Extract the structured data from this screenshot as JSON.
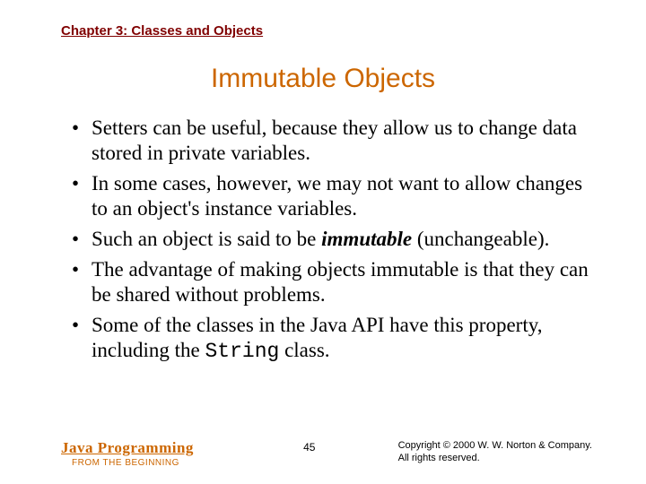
{
  "header": {
    "chapter": "Chapter 3: Classes and Objects"
  },
  "title": "Immutable Objects",
  "bullets": [
    {
      "text": "Setters can be useful, because they allow us to change data stored in private variables."
    },
    {
      "text": "In some cases, however, we may not want to allow changes to an object's instance variables."
    },
    {
      "pre": "Such an object is said to be ",
      "em": "immutable",
      "post": " (unchangeable)."
    },
    {
      "text": "The advantage of making objects immutable is that they can be shared without problems."
    },
    {
      "pre": "Some of the classes in the Java API have this property, including the ",
      "code": "String",
      "post": " class."
    }
  ],
  "footer": {
    "book_title": "Java Programming",
    "book_subtitle": "FROM THE BEGINNING",
    "page_number": "45",
    "copyright_line1": "Copyright © 2000 W. W. Norton & Company.",
    "copyright_line2": "All rights reserved."
  }
}
